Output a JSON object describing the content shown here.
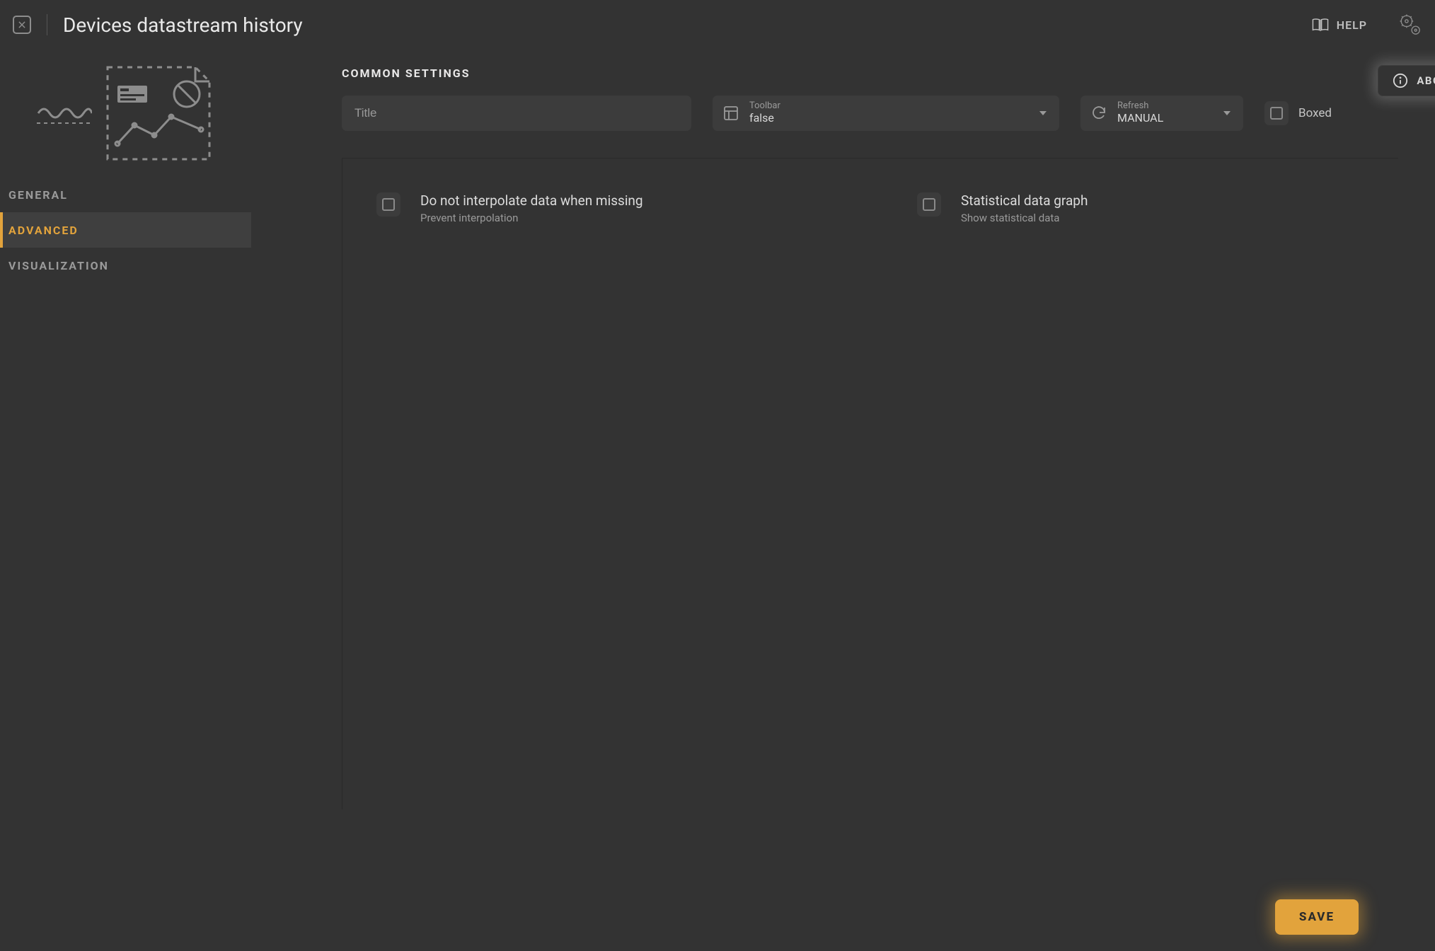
{
  "header": {
    "title": "Devices datastream history",
    "help_label": "HELP"
  },
  "sidebar": {
    "items": [
      {
        "label": "GENERAL"
      },
      {
        "label": "ADVANCED"
      },
      {
        "label": "VISUALIZATION"
      }
    ],
    "active_index": 1
  },
  "common": {
    "section_label": "COMMON SETTINGS",
    "about_label": "ABOUT",
    "title_placeholder": "Title",
    "title_value": "",
    "toolbar_label": "Toolbar",
    "toolbar_value": "false",
    "refresh_label": "Refresh",
    "refresh_value": "MANUAL",
    "boxed_label": "Boxed"
  },
  "advanced": {
    "opt1_title": "Do not interpolate data when missing",
    "opt1_sub": "Prevent interpolation",
    "opt2_title": "Statistical data graph",
    "opt2_sub": "Show statistical data"
  },
  "footer": {
    "save_label": "SAVE"
  }
}
